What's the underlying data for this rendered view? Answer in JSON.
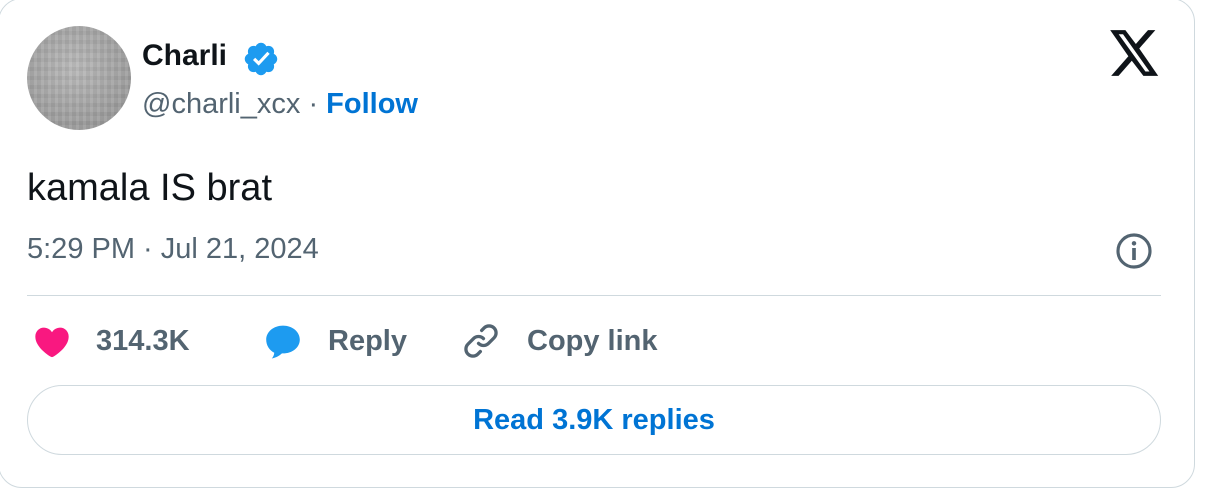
{
  "author": {
    "name": "Charli",
    "handle": "@charli_xcx",
    "separator": "·",
    "follow_label": "Follow",
    "verified_icon": "verified-badge-icon"
  },
  "tweet": {
    "text": "kamala IS brat",
    "timestamp": "5:29 PM · Jul 21, 2024"
  },
  "actions": {
    "like_count": "314.3K",
    "reply_label": "Reply",
    "copy_link_label": "Copy link"
  },
  "read_replies_label": "Read 3.9K replies",
  "icons": {
    "logo": "x-logo-icon",
    "info": "info-icon",
    "like": "heart-icon",
    "reply": "speech-bubble-icon",
    "copy": "link-icon"
  },
  "colors": {
    "text_primary": "#0f1419",
    "text_secondary": "#536471",
    "link_blue": "#0074d4",
    "verified_blue": "#1d9bf0",
    "heart_pink": "#f91880",
    "border": "#cfd9de"
  }
}
